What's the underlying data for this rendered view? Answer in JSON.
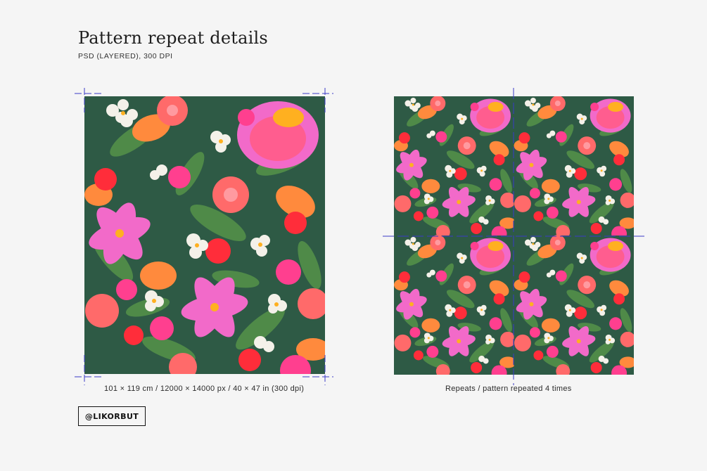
{
  "header": {
    "title": "Pattern repeat details",
    "subtitle": "PSD (LAYERED), 300 DPI"
  },
  "left_panel": {
    "caption": "101 × 119 cm / 12000 × 14000 px / 40 × 47 in (300 dpi)"
  },
  "right_panel": {
    "caption": "Repeats / pattern repeated 4 times"
  },
  "badge": {
    "label": "@LIKORBUT"
  },
  "colors": {
    "background": "#f5f5f5",
    "pattern_bg": "#2e5a45",
    "leaf": "#4e8a4a",
    "pink": "#f26ac9",
    "hot_pink": "#ff3f8f",
    "coral": "#ff6a6a",
    "red": "#ff2d3a",
    "orange": "#ff8a3d",
    "white_flower": "#f4f1e9",
    "guide_blue": "#3a3ac8"
  }
}
